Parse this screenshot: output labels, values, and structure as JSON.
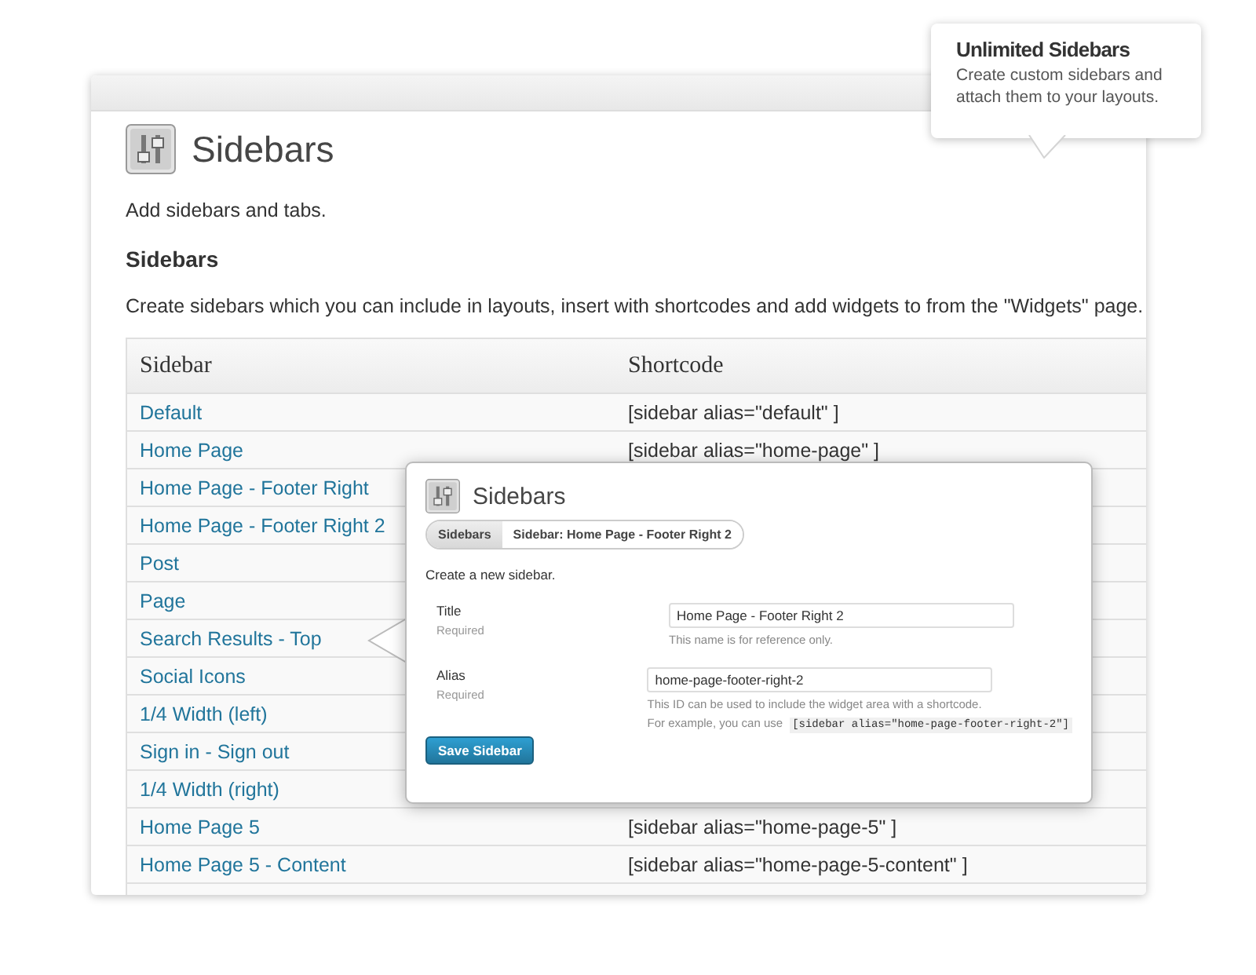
{
  "page": {
    "title": "Sidebars",
    "intro": "Add sidebars and tabs.",
    "section_heading": "Sidebars",
    "section_text": "Create sidebars which you can include in layouts, insert with shortcodes and add widgets to from the \"Widgets\" page."
  },
  "table": {
    "columns": [
      "Sidebar",
      "Shortcode"
    ],
    "rows": [
      {
        "name": "Default",
        "shortcode": "[sidebar alias=\"default\" ]"
      },
      {
        "name": "Home Page",
        "shortcode": "[sidebar alias=\"home-page\" ]"
      },
      {
        "name": "Home Page - Footer Right"
      },
      {
        "name": "Home Page - Footer Right 2"
      },
      {
        "name": "Post"
      },
      {
        "name": "Page"
      },
      {
        "name": "Search Results - Top"
      },
      {
        "name": "Social Icons"
      },
      {
        "name": "1/4 Width (left)"
      },
      {
        "name": "Sign in - Sign out"
      },
      {
        "name": "1/4 Width (right)"
      },
      {
        "name": "Home Page 5",
        "shortcode": "[sidebar alias=\"home-page-5\" ]"
      },
      {
        "name": "Home Page 5 - Content",
        "shortcode": "[sidebar alias=\"home-page-5-content\" ]"
      }
    ]
  },
  "popup": {
    "title": "Sidebars",
    "tabs": [
      {
        "label": "Sidebars",
        "selected": false
      },
      {
        "label": "Sidebar: Home Page - Footer Right 2",
        "selected": true
      }
    ],
    "intro": "Create a new sidebar.",
    "fields": [
      {
        "label": "Title",
        "note": "Required",
        "value": "Home Page - Footer Right 2",
        "hints": [
          "This name is for reference only."
        ]
      },
      {
        "label": "Alias",
        "note": "Required",
        "value": "home-page-footer-right-2",
        "hints": [
          "This ID can be used to include the widget area with a shortcode.",
          "For example, you can use"
        ],
        "code": "[sidebar alias=\"home-page-footer-right-2\"]"
      }
    ],
    "button": "Save Sidebar"
  },
  "callout": {
    "title": "Unlimited Sidebars",
    "text": "Create custom sidebars and attach them to your layouts."
  }
}
